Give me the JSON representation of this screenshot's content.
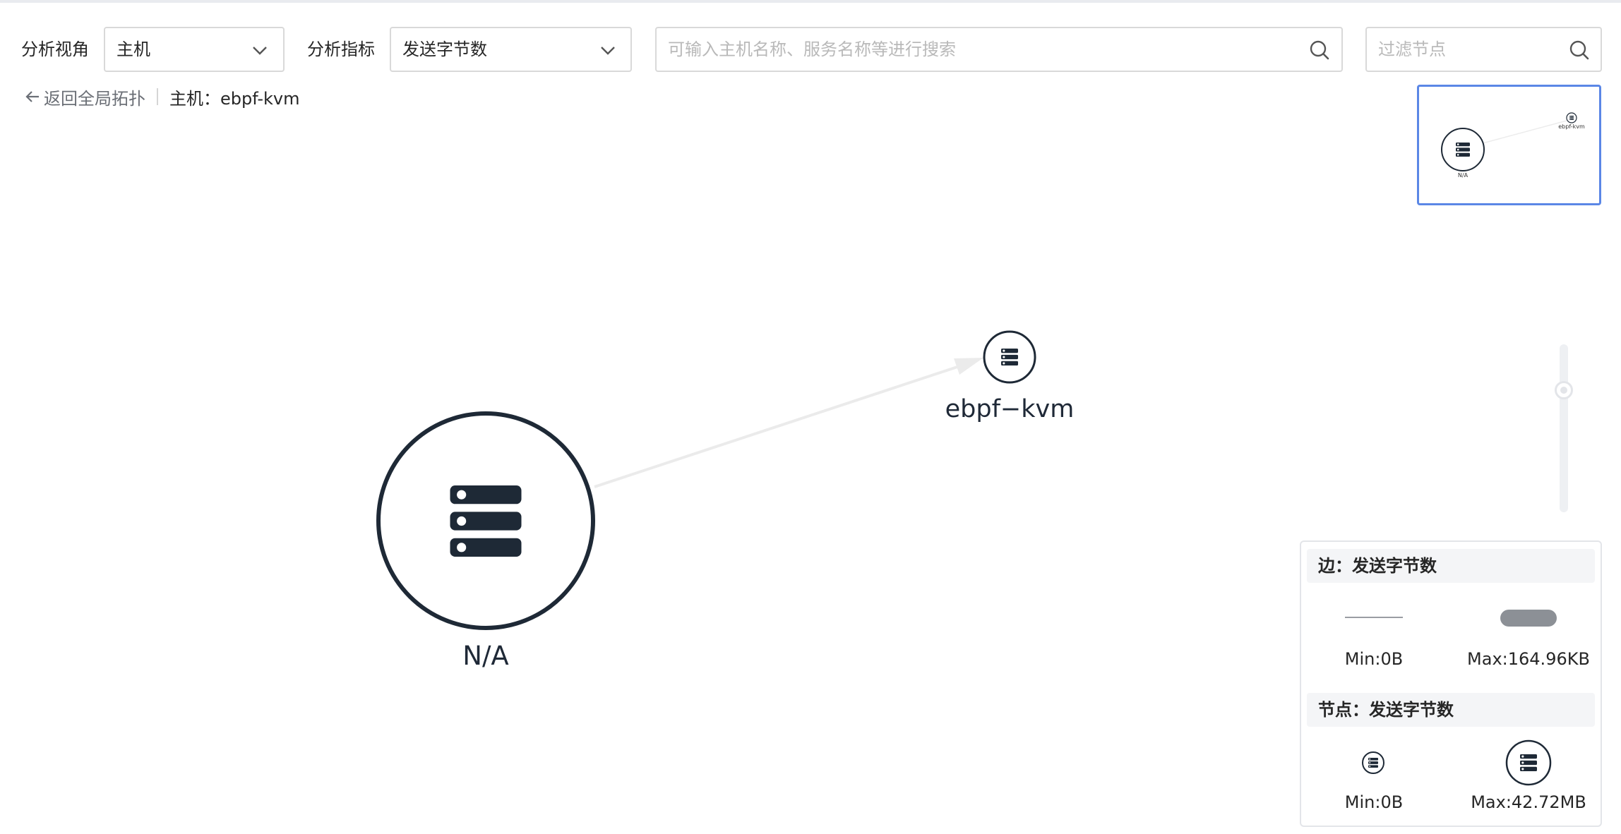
{
  "filters": {
    "view_label": "分析视角",
    "view_value": "主机",
    "metric_label": "分析指标",
    "metric_value": "发送字节数",
    "search_placeholder": "可输入主机名称、服务名称等进行搜索",
    "node_filter_placeholder": "过滤节点"
  },
  "breadcrumb": {
    "back_label": "返回全局拓扑",
    "current": "主机：ebpf-kvm"
  },
  "minimap": {
    "node_small_label": "ebpf-kvm",
    "node_large_label": "N/A"
  },
  "graph": {
    "nodes": [
      {
        "id": "na",
        "label": "N/A"
      },
      {
        "id": "ebpf",
        "label": "ebpf−kvm"
      }
    ],
    "edges": [
      {
        "from": "N/A",
        "to": "ebpf−kvm"
      }
    ]
  },
  "legend": {
    "edge_title": "边：发送字节数",
    "edge_min": "Min:0B",
    "edge_max": "Max:164.96KB",
    "node_title": "节点：发送字节数",
    "node_min": "Min:0B",
    "node_max": "Max:42.72MB"
  },
  "colors": {
    "node_stroke": "#1e2936",
    "edge": "#ebebeb",
    "minimap_border": "#5b87e6",
    "legend_bar": "#8c9096"
  },
  "icons": [
    "chevron-down-icon",
    "search-icon",
    "arrow-left-icon",
    "server-icon"
  ]
}
